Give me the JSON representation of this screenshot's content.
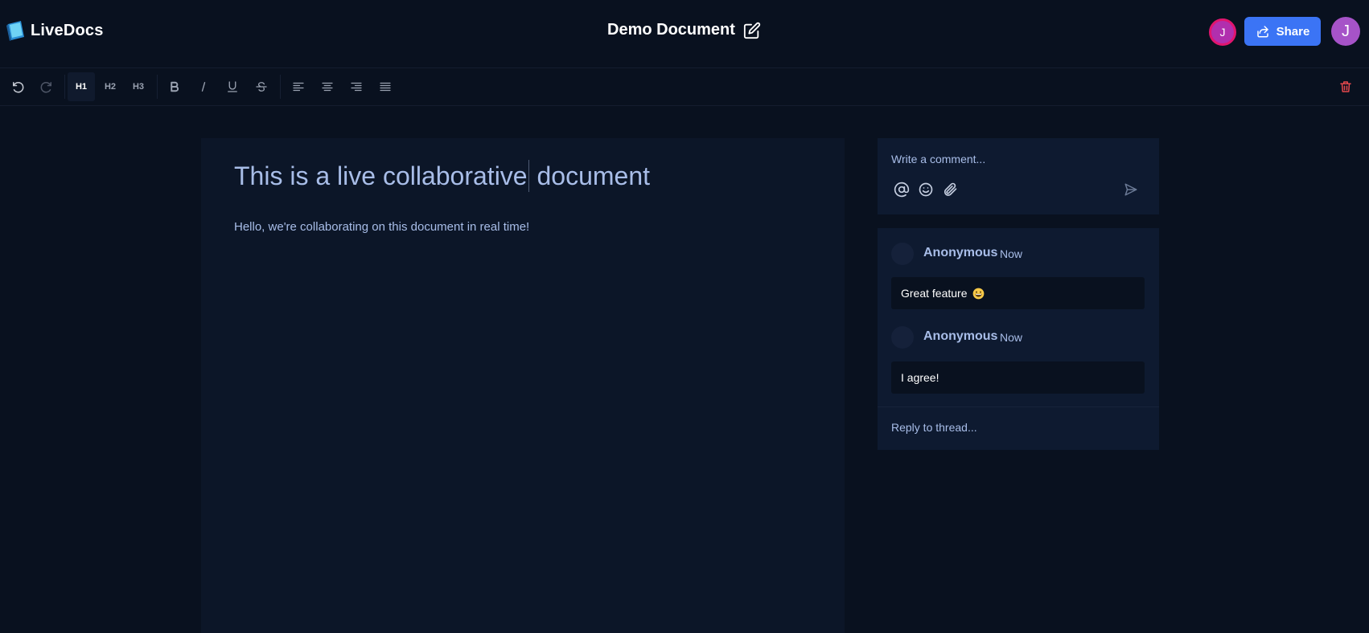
{
  "app": {
    "name": "LiveDocs"
  },
  "document": {
    "title": "Demo Document",
    "heading_before_caret": "This is a live collaborative",
    "heading_after_caret": " document",
    "paragraph": "Hello, we're collaborating on this document in real time!"
  },
  "header": {
    "collaborator_initial": "J",
    "share_label": "Share",
    "user_initial": "J"
  },
  "toolbar": {
    "h1": "H1",
    "h2": "H2",
    "h3": "H3",
    "active_heading": "H1"
  },
  "composer": {
    "placeholder": "Write a comment..."
  },
  "thread": {
    "comments": [
      {
        "author": "Anonymous",
        "time": "Now",
        "text": "Great feature",
        "emoji": "grinning-face"
      },
      {
        "author": "Anonymous",
        "time": "Now",
        "text": "I agree!"
      }
    ],
    "reply_placeholder": "Reply to thread..."
  },
  "colors": {
    "background": "#09111f",
    "editor_surface": "#0c1628",
    "panel": "#0e1a30",
    "accent": "#3b74f5",
    "text_muted": "#a8bde8",
    "delete": "#e5484d"
  }
}
